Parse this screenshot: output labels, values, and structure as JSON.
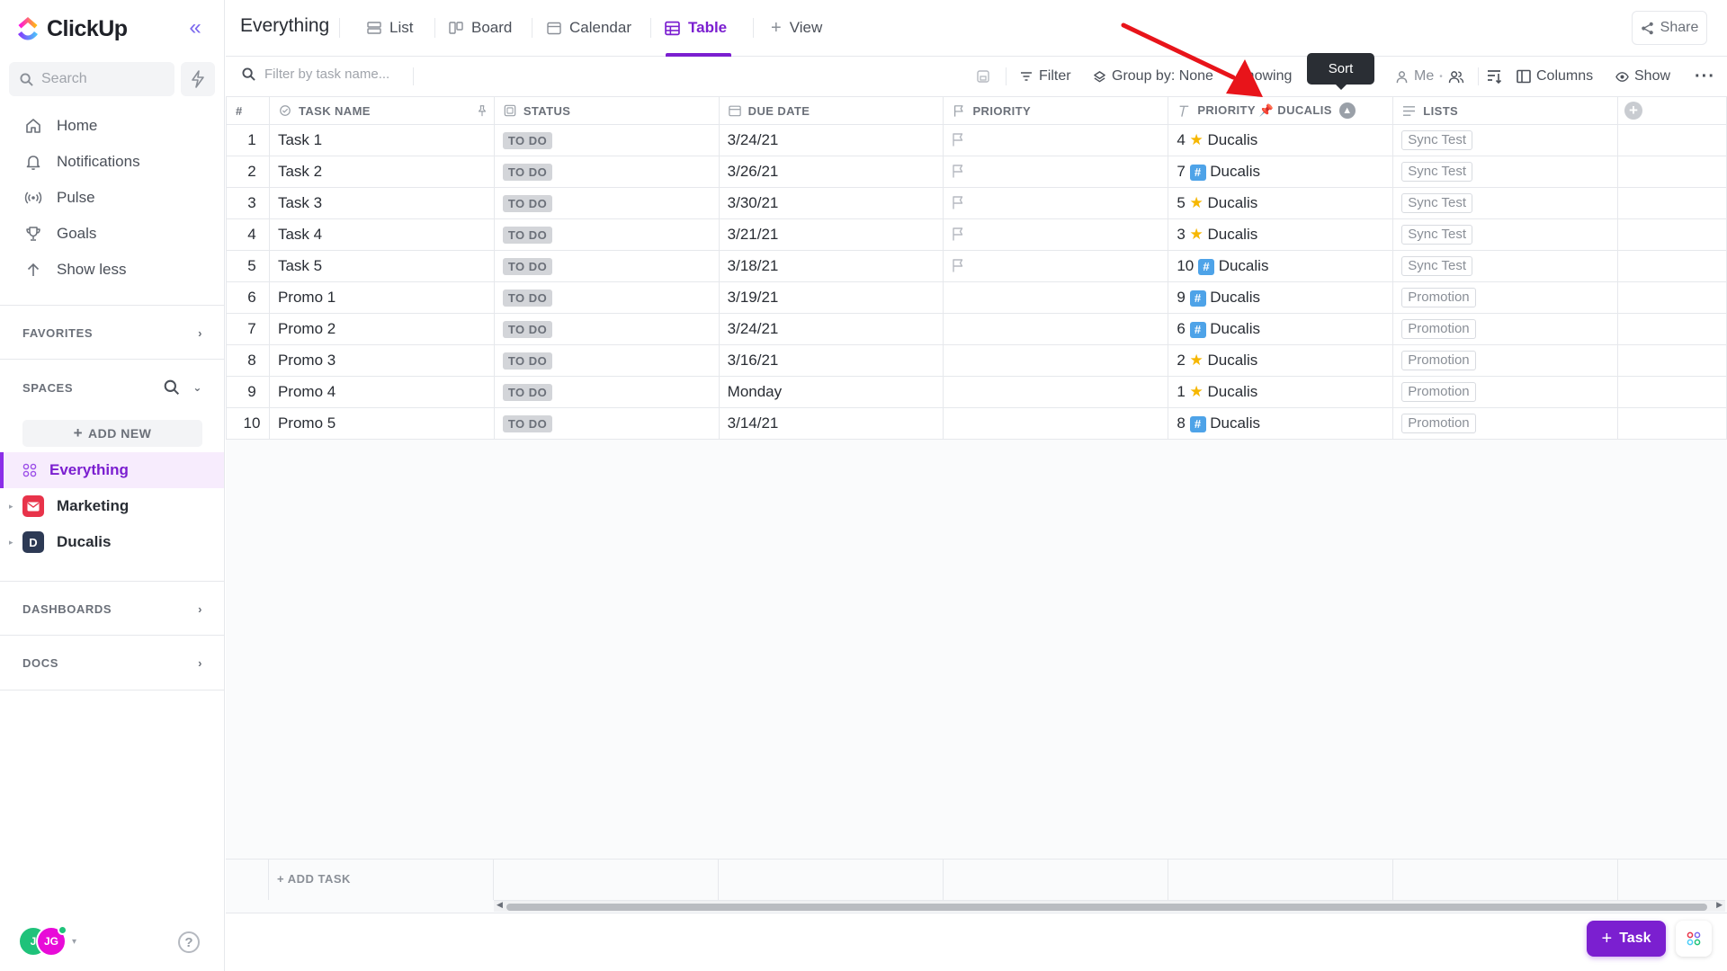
{
  "app": {
    "name": "ClickUp"
  },
  "sidebar": {
    "search_placeholder": "Search",
    "nav": [
      {
        "label": "Home",
        "icon": "home-icon"
      },
      {
        "label": "Notifications",
        "icon": "bell-icon"
      },
      {
        "label": "Pulse",
        "icon": "pulse-icon"
      },
      {
        "label": "Goals",
        "icon": "trophy-icon"
      },
      {
        "label": "Show less",
        "icon": "arrow-up-icon"
      }
    ],
    "favorites_label": "FAVORITES",
    "spaces_label": "SPACES",
    "add_new_label": "ADD NEW",
    "spaces": [
      {
        "label": "Everything",
        "active": true
      },
      {
        "label": "Marketing",
        "color": "#e8334a"
      },
      {
        "label": "Ducalis",
        "badge": "D",
        "color": "#2d3a55"
      }
    ],
    "dashboards_label": "DASHBOARDS",
    "docs_label": "DOCS",
    "user": {
      "initials_1": "J",
      "initials_2": "JG"
    }
  },
  "header": {
    "title": "Everything",
    "tabs": [
      {
        "label": "List"
      },
      {
        "label": "Board"
      },
      {
        "label": "Calendar"
      },
      {
        "label": "Table",
        "active": true
      },
      {
        "label": "View"
      }
    ],
    "share_label": "Share"
  },
  "toolbar": {
    "filter_placeholder": "Filter by task name...",
    "filter_label": "Filter",
    "group_label": "Group by: None",
    "showing_label": "Showing",
    "me_label": "Me",
    "columns_label": "Columns",
    "show_label": "Show",
    "tooltip": "Sort"
  },
  "table": {
    "headers": {
      "num": "#",
      "task_name": "TASK NAME",
      "status": "STATUS",
      "due_date": "DUE DATE",
      "priority": "PRIORITY",
      "ducalis": "PRIORITY 📌 DUCALIS",
      "lists": "LISTS"
    },
    "rows": [
      {
        "num": "1",
        "name": "Task 1",
        "status": "TO DO",
        "due": "3/24/21",
        "flag": true,
        "score": "4",
        "score_icon": "star",
        "ducalis": "Ducalis",
        "list": "Sync Test"
      },
      {
        "num": "2",
        "name": "Task 2",
        "status": "TO DO",
        "due": "3/26/21",
        "flag": true,
        "score": "7",
        "score_icon": "hash",
        "ducalis": "Ducalis",
        "list": "Sync Test"
      },
      {
        "num": "3",
        "name": "Task 3",
        "status": "TO DO",
        "due": "3/30/21",
        "flag": true,
        "score": "5",
        "score_icon": "star",
        "ducalis": "Ducalis",
        "list": "Sync Test"
      },
      {
        "num": "4",
        "name": "Task 4",
        "status": "TO DO",
        "due": "3/21/21",
        "flag": true,
        "score": "3",
        "score_icon": "star",
        "ducalis": "Ducalis",
        "list": "Sync Test"
      },
      {
        "num": "5",
        "name": "Task 5",
        "status": "TO DO",
        "due": "3/18/21",
        "flag": true,
        "score": "10",
        "score_icon": "hash",
        "ducalis": "Ducalis",
        "list": "Sync Test"
      },
      {
        "num": "6",
        "name": "Promo 1",
        "status": "TO DO",
        "due": "3/19/21",
        "flag": false,
        "score": "9",
        "score_icon": "hash",
        "ducalis": "Ducalis",
        "list": "Promotion"
      },
      {
        "num": "7",
        "name": "Promo 2",
        "status": "TO DO",
        "due": "3/24/21",
        "flag": false,
        "score": "6",
        "score_icon": "hash",
        "ducalis": "Ducalis",
        "list": "Promotion"
      },
      {
        "num": "8",
        "name": "Promo 3",
        "status": "TO DO",
        "due": "3/16/21",
        "flag": false,
        "score": "2",
        "score_icon": "star",
        "ducalis": "Ducalis",
        "list": "Promotion"
      },
      {
        "num": "9",
        "name": "Promo 4",
        "status": "TO DO",
        "due": "Monday",
        "flag": false,
        "score": "1",
        "score_icon": "star",
        "ducalis": "Ducalis",
        "list": "Promotion"
      },
      {
        "num": "10",
        "name": "Promo 5",
        "status": "TO DO",
        "due": "3/14/21",
        "flag": false,
        "score": "8",
        "score_icon": "hash",
        "ducalis": "Ducalis",
        "list": "Promotion"
      }
    ],
    "add_task_label": "+ ADD TASK"
  },
  "footer": {
    "task_button_label": "Task"
  },
  "colors": {
    "accent": "#7b1fd0",
    "annotation_arrow": "#e8141a"
  }
}
